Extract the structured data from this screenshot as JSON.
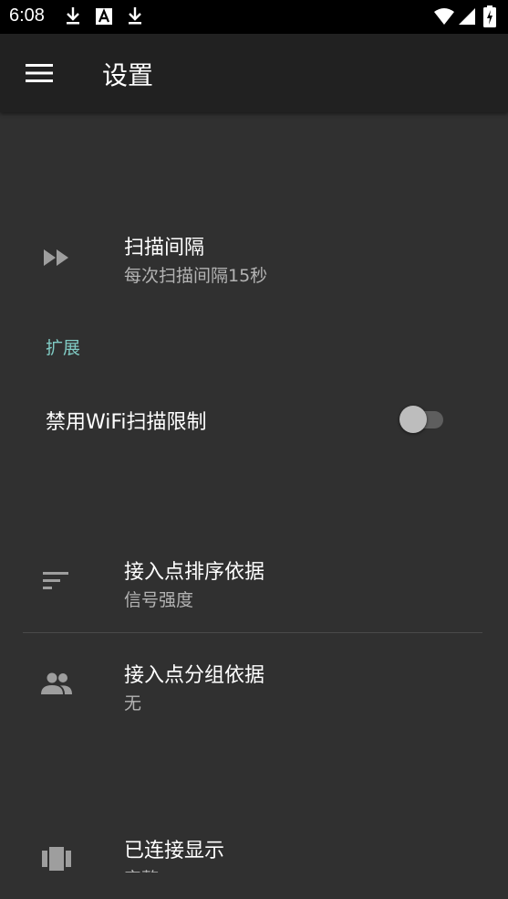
{
  "status_bar": {
    "time": "6:08",
    "icons": [
      "download-icon",
      "font-icon",
      "download-icon",
      "wifi-icon",
      "signal-icon",
      "battery-icon"
    ]
  },
  "app_bar": {
    "title": "设置",
    "menu_icon": "menu-icon"
  },
  "preferences": {
    "scan_interval": {
      "title": "扫描间隔",
      "summary": "每次扫描间隔15秒",
      "icon": "fast-forward-icon"
    },
    "category_extended": "扩展",
    "disable_wifi_throttle": {
      "title": "禁用WiFi扫描限制",
      "enabled": false
    },
    "ap_sort": {
      "title": "接入点排序依据",
      "summary": "信号强度",
      "icon": "sort-icon"
    },
    "ap_group": {
      "title": "接入点分组依据",
      "summary": "无",
      "icon": "group-icon"
    },
    "connected_display": {
      "title": "已连接显示",
      "summary": "完整",
      "icon": "view-carousel-icon"
    }
  },
  "colors": {
    "background": "#303030",
    "app_bar": "#212121",
    "status_bar": "#000000",
    "accent": "#80cbc4",
    "secondary_text": "#b3b3b3",
    "icon": "#9e9e9e"
  }
}
